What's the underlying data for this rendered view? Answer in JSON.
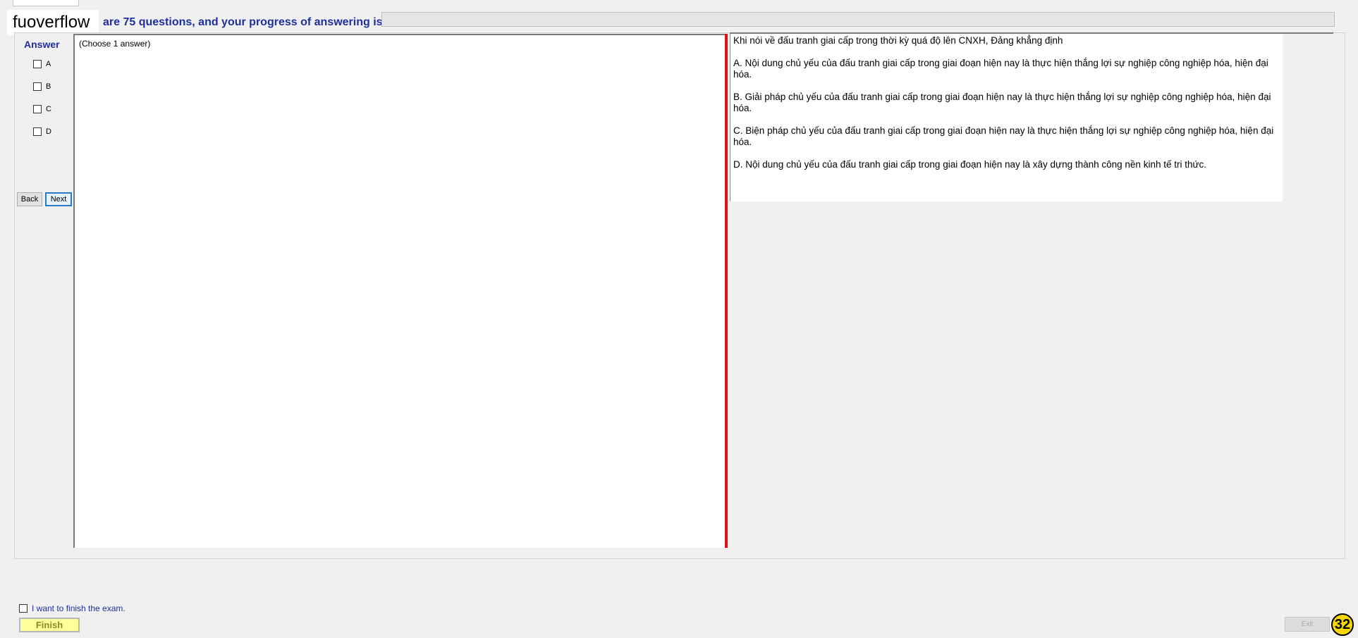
{
  "header": {
    "watermark": "fuoverflow",
    "progress_text": "are 75 questions, and your progress of answering is",
    "progress_value": 0
  },
  "answer_panel": {
    "title": "Answer",
    "options": [
      "A",
      "B",
      "C",
      "D"
    ],
    "back_label": "Back",
    "next_label": "Next"
  },
  "content": {
    "instruction": "(Choose 1 answer)"
  },
  "question": {
    "title": "Khi nói về đấu tranh giai cấp trong thời kỳ quá độ lên CNXH, Đảng khẳng định",
    "options": [
      "A.  Nội dung chủ yếu của đấu tranh giai cấp trong giai đoạn hiện nay là thực hiện thắng lợi sự nghiệp công nghiệp hóa, hiện đại hóa.",
      "B.  Giải pháp chủ yếu của đấu tranh giai cấp trong giai đoạn hiện nay là thực hiện thắng lợi sự nghiệp công nghiệp hóa, hiện đại hóa.",
      "C.  Biện pháp chủ yếu của đấu tranh giai cấp trong giai đoạn hiện nay là thực hiện thắng lợi sự nghiệp công nghiệp hóa, hiện đại hóa.",
      "D.  Nội dung chủ yếu của đấu tranh giai cấp trong giai đoạn hiện nay là xây dựng thành công nền kinh tế tri thức."
    ]
  },
  "footer": {
    "finish_check_label": "I want to finish the exam.",
    "finish_label": "Finish",
    "exit_label": "Exit",
    "badge_number": "32"
  },
  "colors": {
    "accent": "#1f2f9c",
    "divider": "#e01010",
    "finish_bg": "#ffff99",
    "badge": "#f5d800"
  }
}
